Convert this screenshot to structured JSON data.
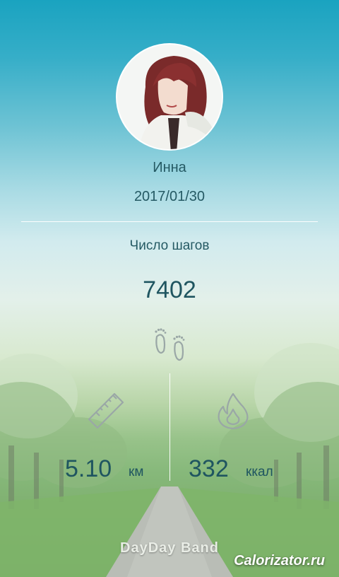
{
  "profile": {
    "name": "Инна",
    "date": "2017/01/30"
  },
  "steps": {
    "label": "Число шагов",
    "value": "7402"
  },
  "distance": {
    "value": "5.10",
    "unit": "км"
  },
  "calories": {
    "value": "332",
    "unit": "ккал"
  },
  "footer": {
    "brand": "DayDay Band",
    "watermark": "Calorizator.ru"
  },
  "icons": {
    "steps": "footprints-icon",
    "distance": "ruler-icon",
    "calories": "flame-icon"
  },
  "colors": {
    "text": "#255a64",
    "divider": "#ffffff",
    "icon_stroke": "#9aa7a6"
  }
}
